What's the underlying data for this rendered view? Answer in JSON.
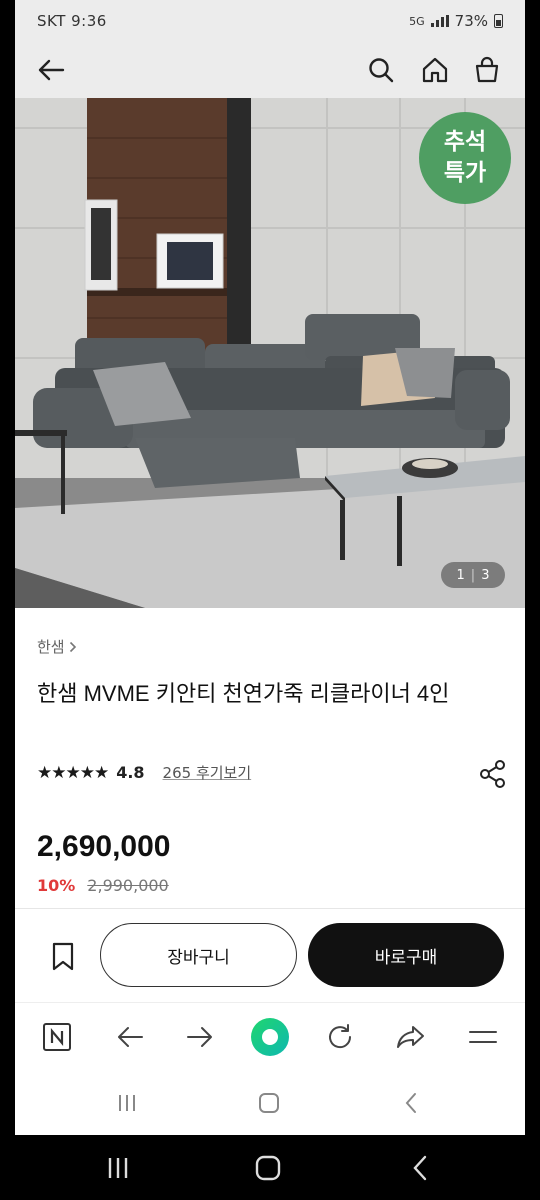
{
  "status_bar": {
    "carrier_time": "SKT 9:36",
    "signal_label": "5G",
    "battery": "73%"
  },
  "app_bar": {
    "icons": [
      "back-arrow-icon",
      "search-icon",
      "home-icon",
      "shopping-bag-icon"
    ]
  },
  "hero": {
    "badge_line1": "추석",
    "badge_line2": "특가",
    "pager_current": "1",
    "pager_total": "3"
  },
  "product": {
    "brand": "한샘",
    "title": "한샘 MVME 키안티 천연가죽 리클라이너 4인",
    "rating": "4.8",
    "stars": "★★★★★",
    "review_link": "265 후기보기",
    "price": "2,690,000",
    "discount": "10%",
    "original_price": "2,990,000"
  },
  "actions": {
    "cart_label": "장바구니",
    "buy_label": "바로구매"
  },
  "browser_bar": {
    "icons": [
      "naver-n-icon",
      "back-icon",
      "forward-icon",
      "green-home-icon",
      "refresh-icon",
      "share-icon",
      "menu-icon"
    ]
  },
  "colors": {
    "accent_green": "#4f9e62",
    "discount_red": "#e03a3a",
    "buy_button": "#111111"
  }
}
